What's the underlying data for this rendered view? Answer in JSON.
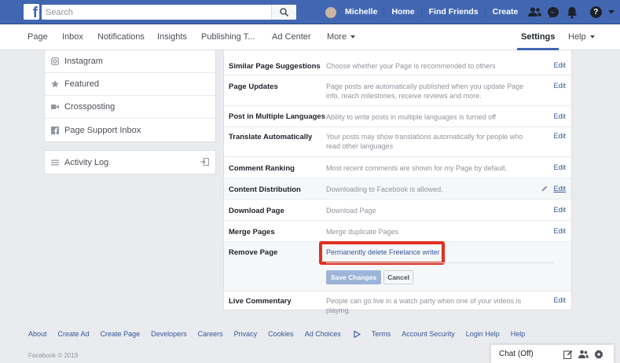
{
  "topbar": {
    "search_placeholder": "Search",
    "user_name": "Michelle",
    "nav_links": [
      "Home",
      "Find Friends",
      "Create"
    ]
  },
  "page_nav": {
    "items": [
      "Page",
      "Inbox",
      "Notifications",
      "Insights",
      "Publishing T...",
      "Ad Center",
      "More"
    ],
    "settings": "Settings",
    "help": "Help"
  },
  "sidebar": {
    "items": [
      "Instagram",
      "Featured",
      "Crossposting",
      "Page Support Inbox"
    ],
    "activity_log": "Activity Log"
  },
  "settings": {
    "rows": [
      {
        "label": "Similar Page Suggestions",
        "desc": "Choose whether your Page is recommended to others",
        "edit": "Edit"
      },
      {
        "label": "Page Updates",
        "desc": "Page posts are automatically published when you update Page info, reach milestones, receive reviews and more.",
        "edit": "Edit"
      },
      {
        "label": "Post in Multiple Languages",
        "desc": "Ability to write posts in multiple languages is turned off",
        "edit": "Edit"
      },
      {
        "label": "Translate Automatically",
        "desc": "Your posts may show translations automatically for people who read other languages",
        "edit": "Edit"
      },
      {
        "label": "Comment Ranking",
        "desc": "Most recent comments are shown for my Page by default.",
        "edit": "Edit"
      },
      {
        "label": "Content Distribution",
        "desc": "Downloading to Facebook is allowed.",
        "edit": "Edit"
      },
      {
        "label": "Download Page",
        "desc": "Download Page",
        "edit": "Edit"
      },
      {
        "label": "Merge Pages",
        "desc": "Merge duplicate Pages",
        "edit": "Edit"
      }
    ],
    "remove_label": "Remove Page",
    "remove_link": "Permanently delete Freelance writer",
    "save_button": "Save Changes",
    "cancel_button": "Cancel",
    "live_label": "Live Commentary",
    "live_desc": "People can go live in a watch party when one of your videos is playing.",
    "live_edit": "Edit"
  },
  "footer": {
    "links": [
      "About",
      "Create Ad",
      "Create Page",
      "Developers",
      "Careers",
      "Privacy",
      "Cookies",
      "Ad Choices",
      "Terms",
      "Account Security",
      "Login Help",
      "Help"
    ],
    "copyright": "Facebook © 2019"
  },
  "chat": {
    "label": "Chat (Off)"
  },
  "colors": {
    "brand": "#4267b2",
    "link": "#365899",
    "highlight": "#e0301e"
  }
}
